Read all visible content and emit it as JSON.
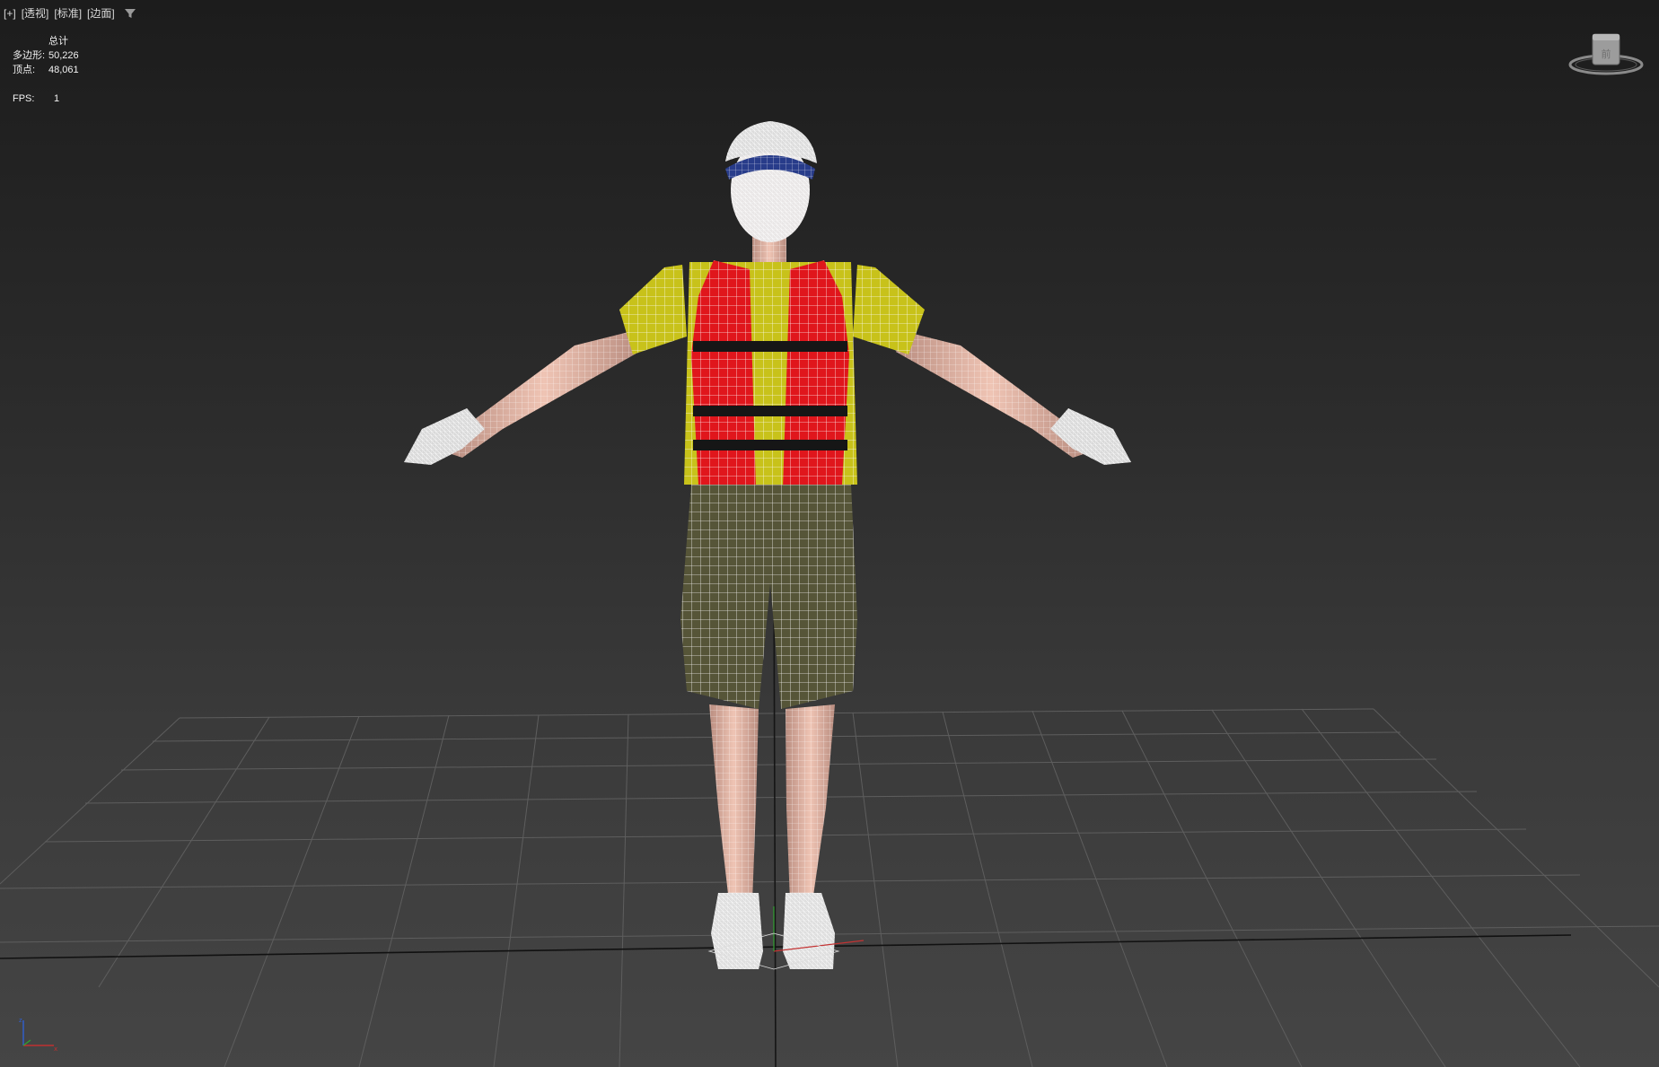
{
  "viewport_menu": {
    "plus": "[+]",
    "view": "[透视]",
    "shading_standard": "[标准]",
    "shading_edge": "[边面]"
  },
  "stats": {
    "title": "总计",
    "polygons_label": "多边形:",
    "polygons_value": "50,226",
    "vertices_label": "顶点:",
    "vertices_value": "48,061",
    "fps_label": "FPS:",
    "fps_value": "1"
  },
  "viewcube": {
    "label": "前",
    "icon": "viewcube-icon"
  },
  "colors": {
    "background_top": "#1c1c1c",
    "background_bottom": "#454545",
    "grid": "#5a5a5a",
    "vest": "#e0161c",
    "shirt": "#c8c21a",
    "shorts": "#565538",
    "skin": "#e8b7a6",
    "wire": "#ffffff"
  }
}
